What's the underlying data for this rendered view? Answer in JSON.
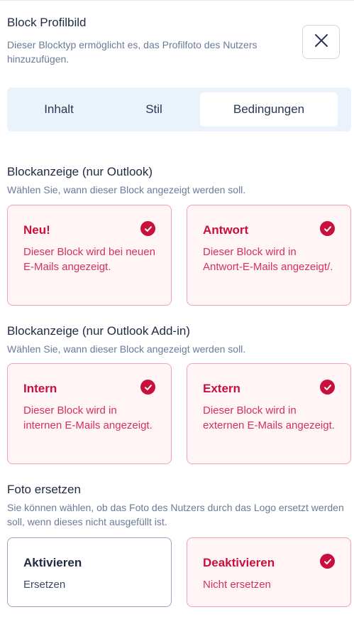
{
  "header": {
    "title": "Block Profilbild",
    "subtitle": "Dieser Blocktyp ermöglicht es, das Profilfoto des Nutzers hinzuzufügen."
  },
  "tabs": [
    {
      "label": "Inhalt",
      "active": false
    },
    {
      "label": "Stil",
      "active": false
    },
    {
      "label": "Bedingungen",
      "active": true
    }
  ],
  "sections": {
    "outlook": {
      "title": "Blockanzeige (nur Outlook)",
      "subtitle": "Wählen Sie, wann dieser Block angezeigt werden soll.",
      "options": [
        {
          "title": "Neu!",
          "description": "Dieser Block wird bei neuen E-Mails angezeigt.",
          "selected": true
        },
        {
          "title": "Antwort",
          "description": "Dieser Block wird in Antwort-E-Mails angezeigt/.",
          "selected": true
        }
      ]
    },
    "addin": {
      "title": "Blockanzeige (nur Outlook Add-in)",
      "subtitle": "Wählen Sie, wann dieser Block angezeigt werden soll.",
      "options": [
        {
          "title": "Intern",
          "description": "Dieser Block wird in internen E-Mails angezeigt.",
          "selected": true
        },
        {
          "title": "Extern",
          "description": "Dieser Block wird in externen E-Mails angezeigt.",
          "selected": true
        }
      ]
    },
    "photo": {
      "title": "Foto ersetzen",
      "subtitle": "Sie können wählen, ob das Foto des Nutzers durch das Logo ersetzt werden soll, wenn dieses nicht ausgefüllt ist.",
      "options": [
        {
          "title": "Aktivieren",
          "description": "Ersetzen",
          "selected": false
        },
        {
          "title": "Deaktivieren",
          "description": "Nicht ersetzen",
          "selected": true
        }
      ]
    }
  },
  "icons": {
    "close": "close-icon",
    "check": "check-circle-icon"
  },
  "colors": {
    "accent": "#c8103e",
    "selected_bg": "#fff4f6",
    "selected_border": "#f2a3b3",
    "tabs_bg": "#eaf2fb"
  }
}
